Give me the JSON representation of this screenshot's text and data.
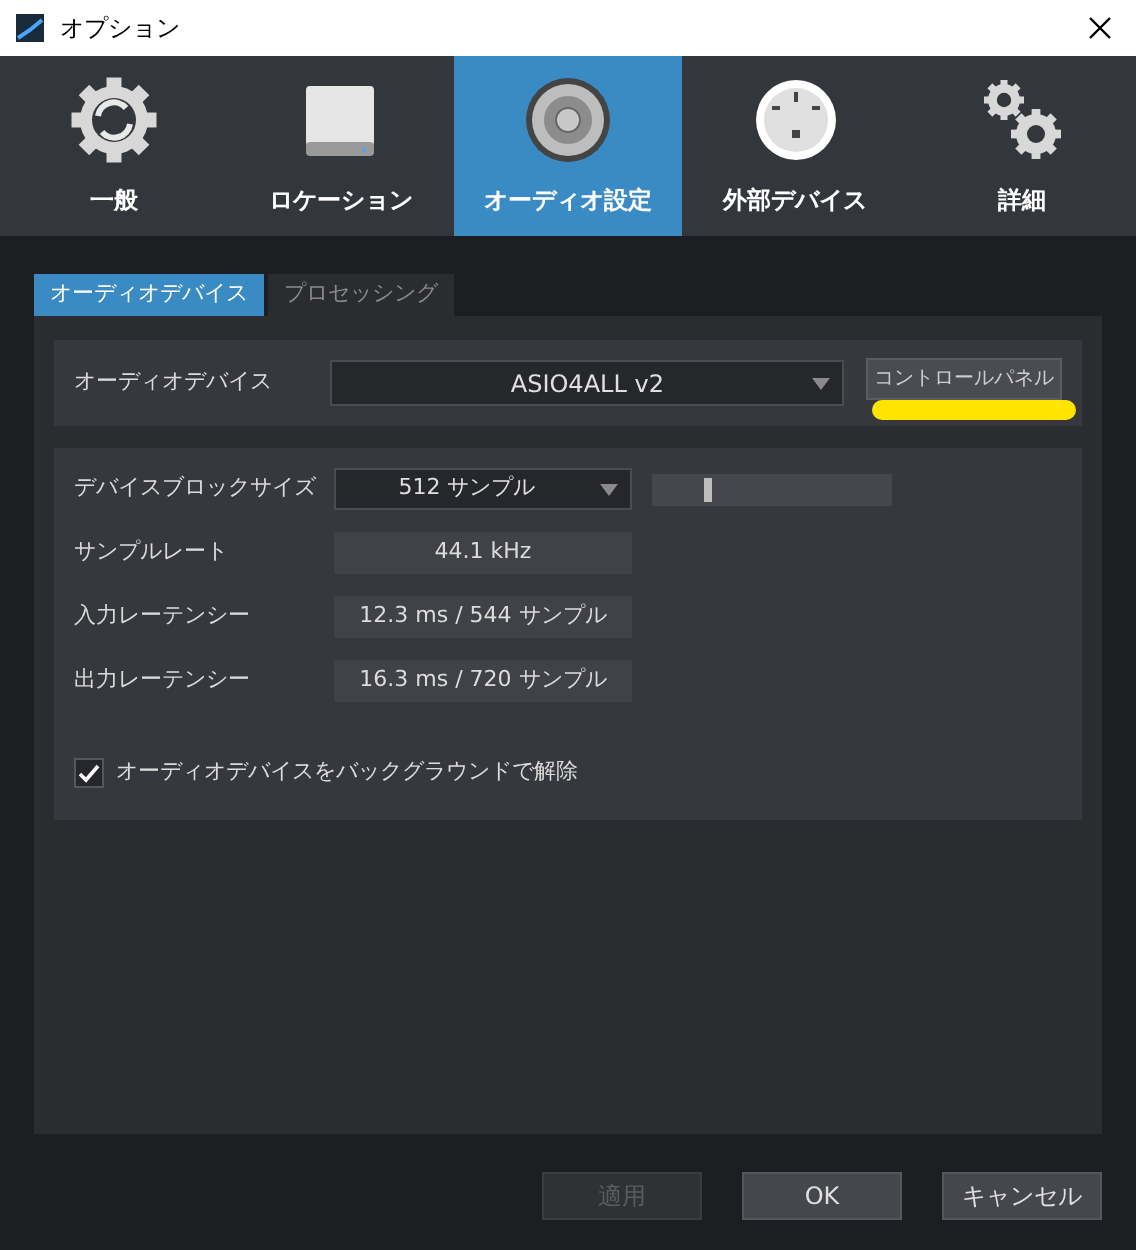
{
  "window": {
    "title": "オプション"
  },
  "categories": [
    {
      "label": "一般",
      "selected": false
    },
    {
      "label": "ロケーション",
      "selected": false
    },
    {
      "label": "オーディオ設定",
      "selected": true
    },
    {
      "label": "外部デバイス",
      "selected": false
    },
    {
      "label": "詳細",
      "selected": false
    }
  ],
  "subtabs": [
    {
      "label": "オーディオデバイス",
      "selected": true
    },
    {
      "label": "プロセッシング",
      "selected": false
    }
  ],
  "device": {
    "label": "オーディオデバイス",
    "value": "ASIO4ALL v2",
    "button": "コントロールパネル"
  },
  "block_size": {
    "label": "デバイスブロックサイズ",
    "value": "512 サンプル",
    "level": 0.23
  },
  "readouts": [
    {
      "label": "サンプルレート",
      "value": "44.1 kHz"
    },
    {
      "label": "入力レーテンシー",
      "value": "12.3 ms / 544 サンプル"
    },
    {
      "label": "出力レーテンシー",
      "value": "16.3 ms / 720 サンプル"
    }
  ],
  "background_release": {
    "label": "オーディオデバイスをバックグラウンドで解除",
    "checked": true
  },
  "buttons": [
    {
      "label": "適用",
      "disabled": true
    },
    {
      "label": "OK",
      "disabled": false
    },
    {
      "label": "キャンセル",
      "disabled": false
    }
  ]
}
